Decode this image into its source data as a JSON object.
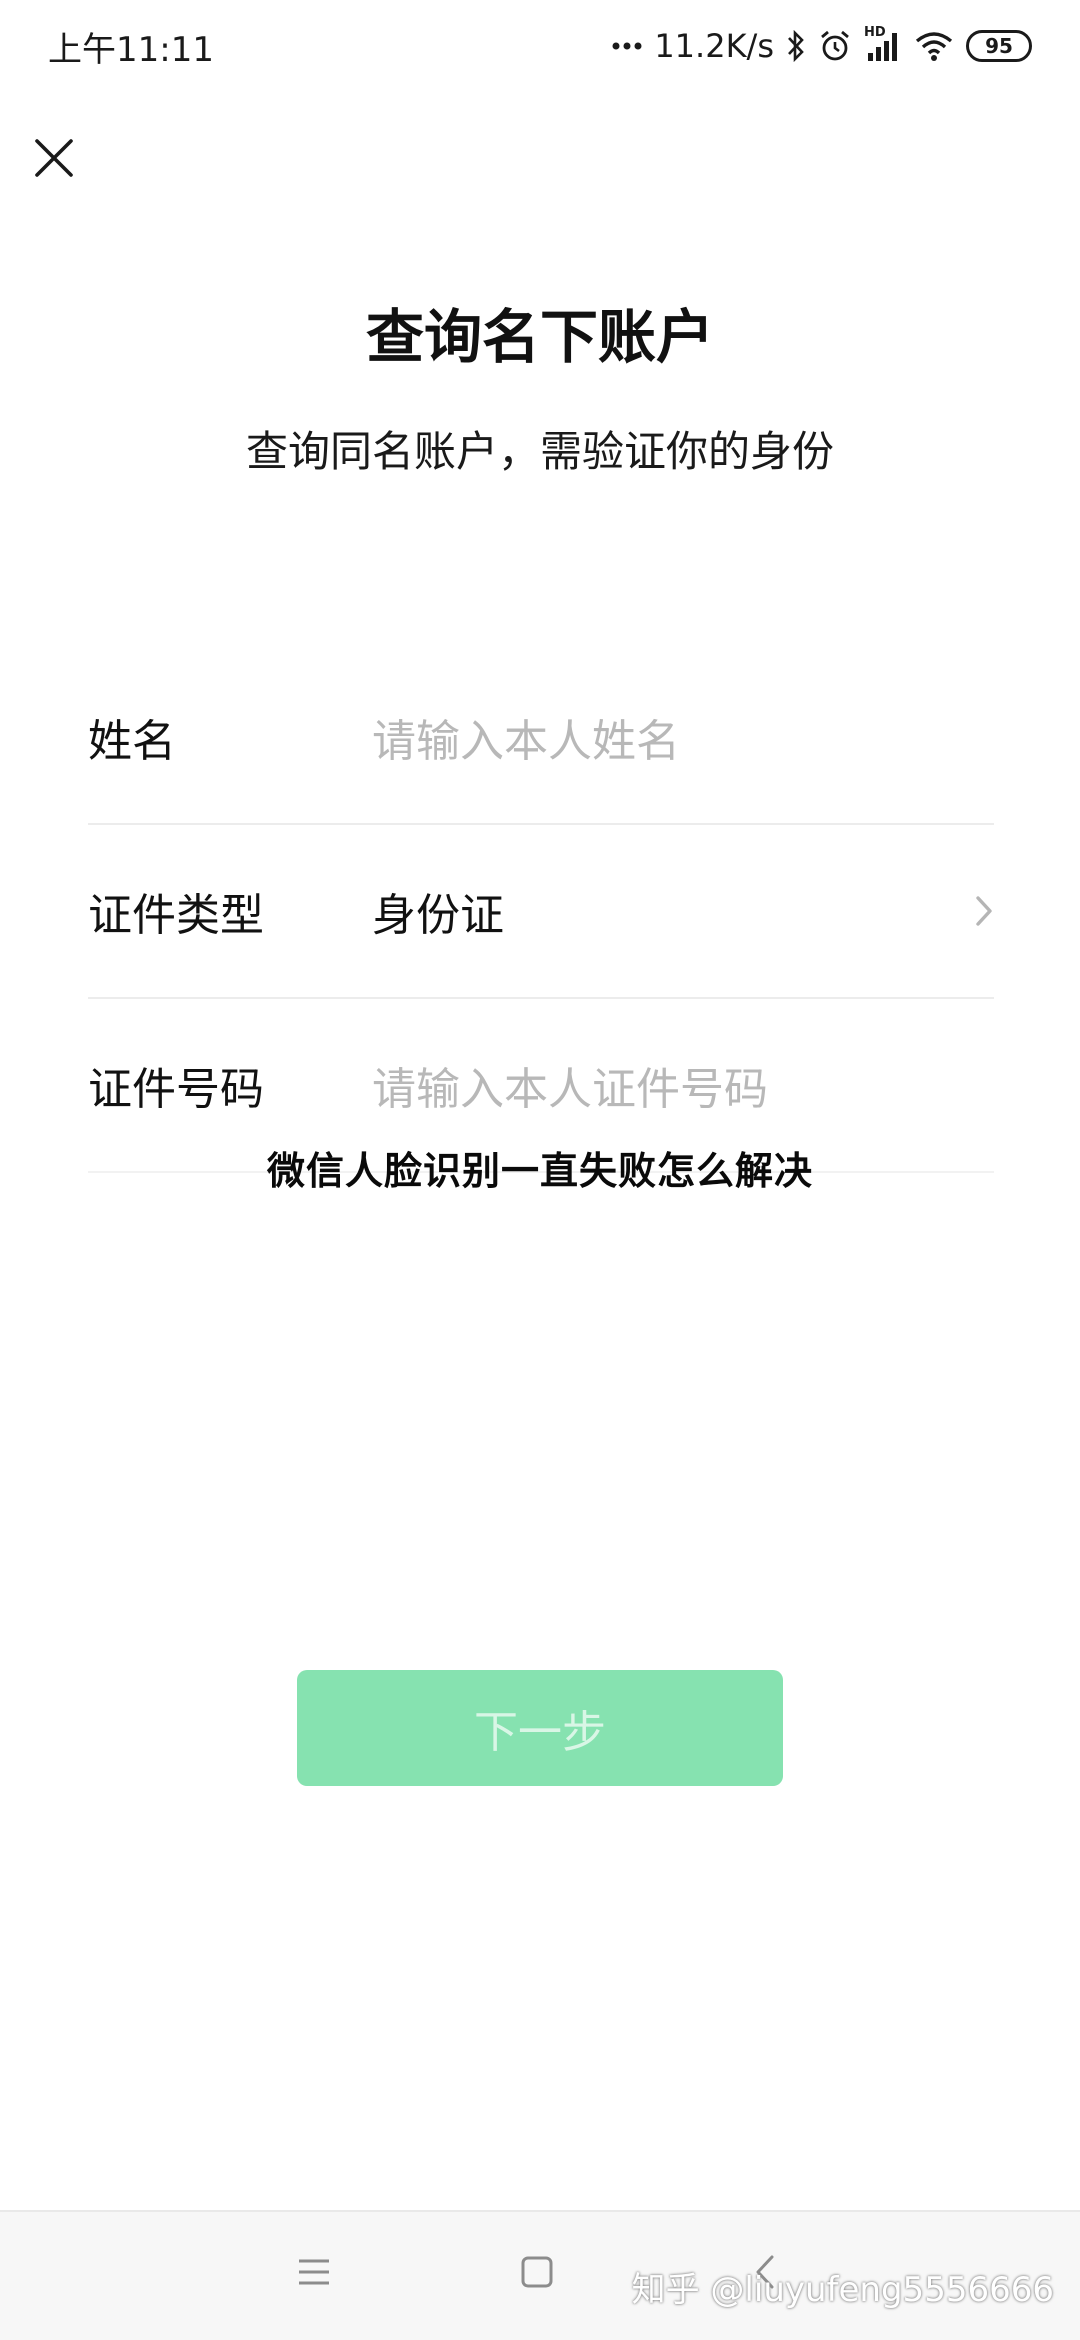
{
  "status_bar": {
    "time": "上午11:11",
    "network_speed": "11.2K/s",
    "hd_label": "HD",
    "battery": "95",
    "icons": [
      "dots-icon",
      "bluetooth-icon",
      "alarm-icon",
      "signal-icon",
      "wifi-icon",
      "battery-icon"
    ]
  },
  "header": {
    "close_icon": "close-icon",
    "title": "查询名下账户",
    "subtitle": "查询同名账户，需验证你的身份"
  },
  "form": {
    "name": {
      "label": "姓名",
      "placeholder": "请输入本人姓名"
    },
    "id_type": {
      "label": "证件类型",
      "value": "身份证",
      "icon": "chevron-right-icon"
    },
    "id_number": {
      "label": "证件号码",
      "placeholder": "请输入本人证件号码"
    }
  },
  "overlay_text": "微信人脸识别一直失败怎么解决",
  "next_button": {
    "label": "下一步",
    "color": "#86e2b0"
  },
  "nav_bar": {
    "icons": [
      "menu-icon",
      "home-icon",
      "back-icon"
    ]
  },
  "watermark": "知乎 @liuyufeng5556666"
}
